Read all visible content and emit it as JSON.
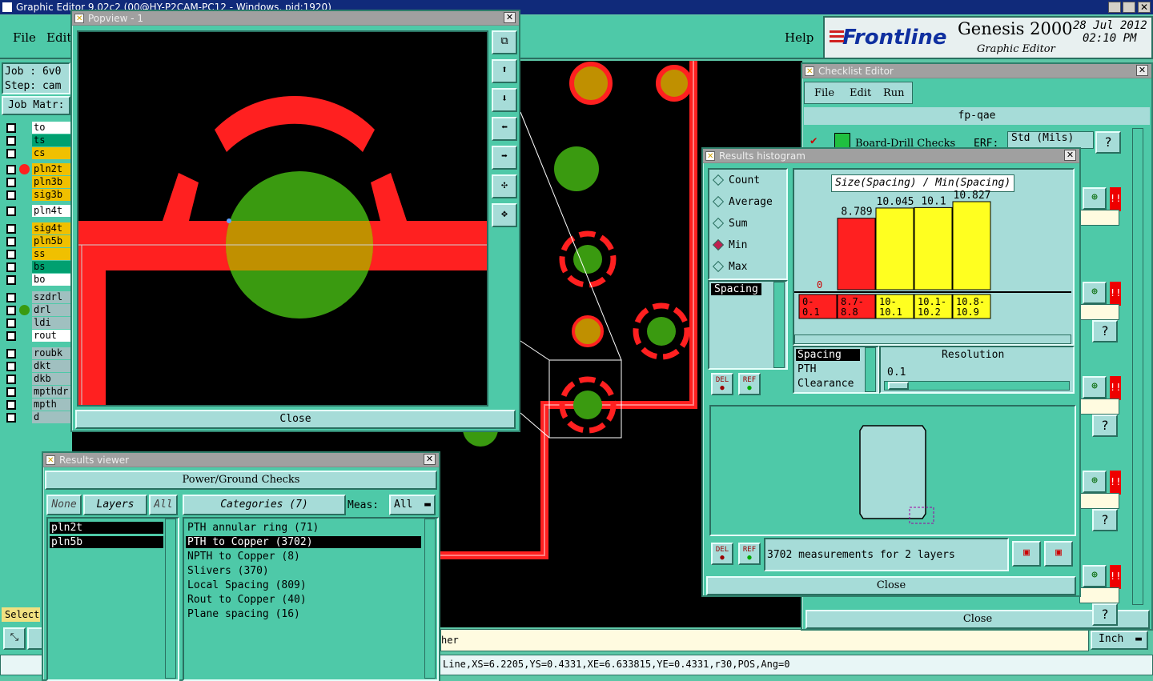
{
  "app_title": "Graphic Editor 9.02c2 (00@HY-P2CAM-PC12 - Windows, pid:1920)",
  "menu": {
    "file": "File",
    "edit": "Edit",
    "help": "Help"
  },
  "job": {
    "job_label": "Job : 6v0",
    "step_label": "Step: cam",
    "matrix_label": "Job Matr:"
  },
  "layers": [
    {
      "name": "to",
      "color": "#ffffff"
    },
    {
      "name": "ts",
      "color": "#00a070"
    },
    {
      "name": "cs",
      "color": "#f0c000"
    },
    {
      "name": "pln2t",
      "color": "#f0c000"
    },
    {
      "name": "pln3b",
      "color": "#f0c000"
    },
    {
      "name": "sig3b",
      "color": "#f0c000"
    },
    {
      "name": "pln4t",
      "color": "#ffffff"
    },
    {
      "name": "sig4t",
      "color": "#f0c000"
    },
    {
      "name": "pln5b",
      "color": "#f0c000"
    },
    {
      "name": "ss",
      "color": "#f0c000"
    },
    {
      "name": "bs",
      "color": "#00a070"
    },
    {
      "name": "bo",
      "color": "#ffffff"
    },
    {
      "name": "szdrl",
      "color": "#a0c0c0"
    },
    {
      "name": "drl",
      "color": "#a0c0c0"
    },
    {
      "name": "ldi",
      "color": "#a0c0c0"
    },
    {
      "name": "rout",
      "color": "#ffffff"
    },
    {
      "name": "roubk",
      "color": "#a0c0c0"
    },
    {
      "name": "dkt",
      "color": "#a0c0c0"
    },
    {
      "name": "dkb",
      "color": "#a0c0c0"
    },
    {
      "name": "mpthdr",
      "color": "#a0c0c0"
    },
    {
      "name": "mpth",
      "color": "#a0c0c0"
    },
    {
      "name": "d",
      "color": "#a0c0c0"
    }
  ],
  "select_label": "Select",
  "brand": {
    "logo": "Frontline",
    "product": "Genesis 2000",
    "sub": "Graphic Editor",
    "date": "28 Jul 2012",
    "time": "02:10 PM"
  },
  "popview": {
    "title": "Popview - 1",
    "close": "Close"
  },
  "results_viewer": {
    "title": "Results viewer",
    "header": "Power/Ground Checks",
    "none": "None",
    "layers": "Layers",
    "all": "All",
    "categories_label": "Categories (7)",
    "meas_label": "Meas:",
    "meas_value": "All",
    "layer_items": [
      "pln2t",
      "pln5b"
    ],
    "categories": [
      "PTH annular ring (71)",
      "PTH to Copper (3702)",
      "NPTH to Copper (8)",
      "Slivers (370)",
      "Local Spacing (809)",
      "Rout to Copper (40)",
      "Plane spacing (16)"
    ]
  },
  "histogram": {
    "title": "Results histogram",
    "modes": [
      "Count",
      "Average",
      "Sum",
      "Min",
      "Max"
    ],
    "selected_mode": "Min",
    "list_item": "Spacing",
    "chart_title": "Size(Spacing) / Min(Spacing)",
    "zero": "0",
    "bins": [
      {
        "label": "0-\n0.1",
        "value": 0,
        "display": "",
        "color": "#ff2020"
      },
      {
        "label": "8.7-\n8.8",
        "value": 8.789,
        "display": "8.789",
        "color": "#ff2020"
      },
      {
        "label": "10-\n10.1",
        "value": 10.045,
        "display": "10.045",
        "color": "#ffff20"
      },
      {
        "label": "10.1-\n10.2",
        "value": 10.1,
        "display": "10.1",
        "color": "#ffff20"
      },
      {
        "label": "10.8-\n10.9",
        "value": 10.827,
        "display": "10.827",
        "color": "#ffff20"
      }
    ],
    "attrs": [
      "Spacing",
      "PTH",
      "Clearance"
    ],
    "resolution_label": "Resolution",
    "resolution_value": "0.1",
    "del": "DEL",
    "ref": "REF",
    "measurements": "3702 measurements for 2 layers",
    "close": "Close"
  },
  "checklist": {
    "title": "Checklist Editor",
    "file": "File",
    "edit": "Edit",
    "run": "Run",
    "name": "fp-qae",
    "row1": "Board-Drill Checks",
    "erf": "ERF:",
    "std": "Std (Mils)",
    "close": "Close",
    "help": "?"
  },
  "status": {
    "coords": "Line,XS=6.2205,YS=0.4331,XE=6.633815,YE=0.4331,r30,POS,Ang=0",
    "units": "Inch",
    "frag": "her"
  }
}
